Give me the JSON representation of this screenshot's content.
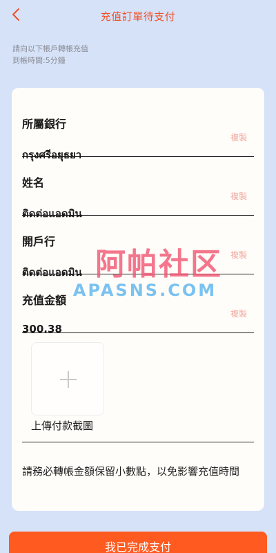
{
  "header": {
    "title": "充值訂單待支付",
    "back_icon": "chevron-left-icon"
  },
  "instructions": {
    "line1": "請向以下帳戶轉帳充值",
    "line2": "到帳時間:5分鐘"
  },
  "fields": [
    {
      "label": "所屬銀行",
      "value": "กรุงศรีอยุธยา",
      "copy": "複製"
    },
    {
      "label": "姓名",
      "value": "ติดต่อแอดมิน",
      "copy": "複製"
    },
    {
      "label": "開戶行",
      "value": "ติดต่อแอดมิน",
      "copy": "複製"
    },
    {
      "label": "充值金額",
      "value": "300.38",
      "copy": "複製"
    }
  ],
  "upload": {
    "label": "上傳付款截圖",
    "icon": "plus-icon"
  },
  "note": "請務必轉帳金額保留小數點，以免影響充值時間",
  "watermark": {
    "cn": "阿帕社区",
    "en": "APASNS.COM"
  },
  "submit_label": "我已完成支付",
  "colors": {
    "accent": "#f0512a",
    "button": "#ff5a1f",
    "background": "#d6e2f8"
  }
}
